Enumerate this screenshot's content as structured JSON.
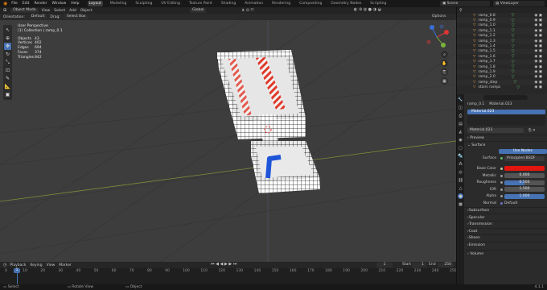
{
  "menu": [
    "File",
    "Edit",
    "Render",
    "Window",
    "Help"
  ],
  "workspaces": [
    "Layout",
    "Modeling",
    "Sculpting",
    "UV Editing",
    "Texture Paint",
    "Shading",
    "Animation",
    "Rendering",
    "Compositing",
    "Geometry Nodes",
    "Scripting"
  ],
  "scene_label": "Scene",
  "view_layer_label": "ViewLayer",
  "header": {
    "mode": "Object Mode",
    "menus": [
      "View",
      "Select",
      "Add",
      "Object"
    ],
    "transform_space": "Global",
    "orientation_label": "Orientation:",
    "orientation_value": "Default",
    "drag_label": "Drag:",
    "drag_value": "Select Box",
    "options_label": "Options"
  },
  "overlay": {
    "view_name": "User Perspective",
    "collection": "(1) Collection | ramp_0.1",
    "stats": [
      {
        "label": "Objects",
        "value": "43"
      },
      {
        "label": "Vertices",
        "value": "402"
      },
      {
        "label": "Edges",
        "value": "694"
      },
      {
        "label": "Faces",
        "value": "374"
      },
      {
        "label": "Triangles",
        "value": "842"
      }
    ]
  },
  "outliner": {
    "items": [
      "ramp_0.8",
      "ramp_0.9",
      "ramp_1.0",
      "ramp_1.1",
      "ramp_1.2",
      "ramp_1.3",
      "ramp_1.4",
      "ramp_1.5",
      "ramp_1.6",
      "ramp_1.7",
      "ramp_1.8",
      "ramp_1.9",
      "ramp_2.0",
      "ramp_step",
      "stairs ramps"
    ]
  },
  "properties": {
    "search_placeholder": "",
    "object_name": "ramp_0.1",
    "material_slot": "Material.023",
    "material_name": "Material.023",
    "preview_label": "Preview",
    "surface_label": "Surface",
    "use_nodes_label": "Use Nodes",
    "surface_field_label": "Surface",
    "surface_shader": "Principled BSDF",
    "fields": [
      {
        "label": "Base Color",
        "value": "",
        "color": "#e3160f"
      },
      {
        "label": "Metallic",
        "value": "0.000"
      },
      {
        "label": "Roughness",
        "value": "0.500"
      },
      {
        "label": "IOR",
        "value": "1.500"
      },
      {
        "label": "Alpha",
        "value": "1.000"
      },
      {
        "label": "Normal",
        "value": "Default"
      }
    ],
    "sections": [
      "Subsurface",
      "Specular",
      "Transmission",
      "Coat",
      "Sheen",
      "Emission"
    ],
    "volume_label": "Volume"
  },
  "timeline": {
    "menus": [
      "Playback",
      "Keying",
      "View",
      "Marker"
    ],
    "current_frame": "1",
    "start_label": "Start",
    "start_value": "1",
    "end_label": "End",
    "end_value": "250",
    "ticks": [
      "0",
      "10",
      "20",
      "30",
      "40",
      "50",
      "60",
      "70",
      "80",
      "90",
      "100",
      "110",
      "120",
      "130",
      "140",
      "150",
      "160",
      "170",
      "180",
      "190",
      "200",
      "210",
      "220",
      "230",
      "240",
      "250"
    ]
  },
  "status": {
    "select": "Select",
    "rotate": "Rotate View",
    "object": "Object",
    "version": "4.1.1"
  },
  "colors": {
    "accent": "#4772b3",
    "stripe_red": "#e03a2a",
    "blue_shape": "#1e54d8",
    "base_color": "#e3160f"
  }
}
